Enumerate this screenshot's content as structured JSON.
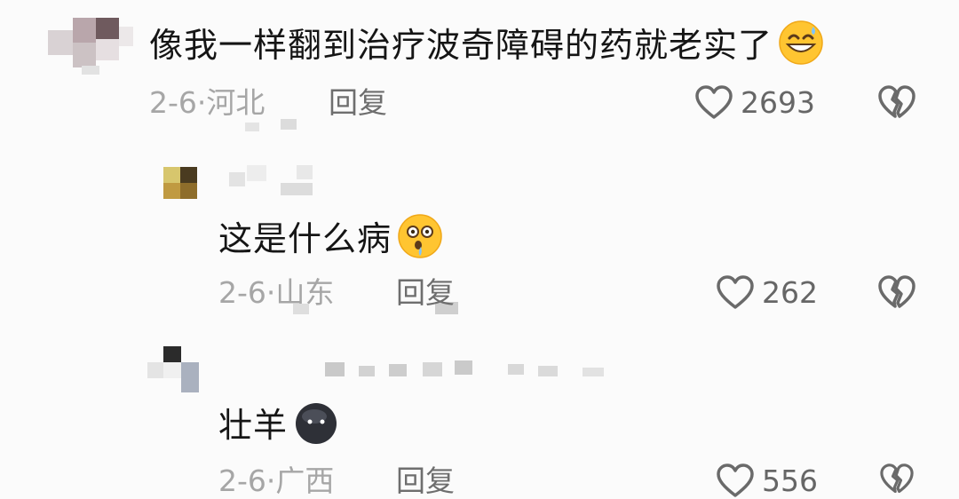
{
  "comments": [
    {
      "text": "像我一样翻到治疗波奇障碍的药就老实了",
      "emoji": "grinning-sweat-emoji",
      "date": "2-6",
      "location": "河北",
      "reply_label": "回复",
      "likes": "2693"
    },
    {
      "text": "这是什么病",
      "emoji": "drooling-shocked-emoji",
      "date": "2-6",
      "location": "山东",
      "reply_label": "回复",
      "likes": "262"
    },
    {
      "text": "壮羊",
      "emoji": "dark-face-emoji",
      "date": "2-6",
      "location": "广西",
      "reply_label": "回复",
      "likes": "556"
    }
  ],
  "meta_separator": "·",
  "icons": {
    "like": "heart-outline-icon",
    "dislike": "broken-heart-icon"
  },
  "colors": {
    "text": "#151515",
    "meta": "#a6a6a6",
    "reply": "#6e6e6e",
    "icon": "#6a6a6a"
  }
}
